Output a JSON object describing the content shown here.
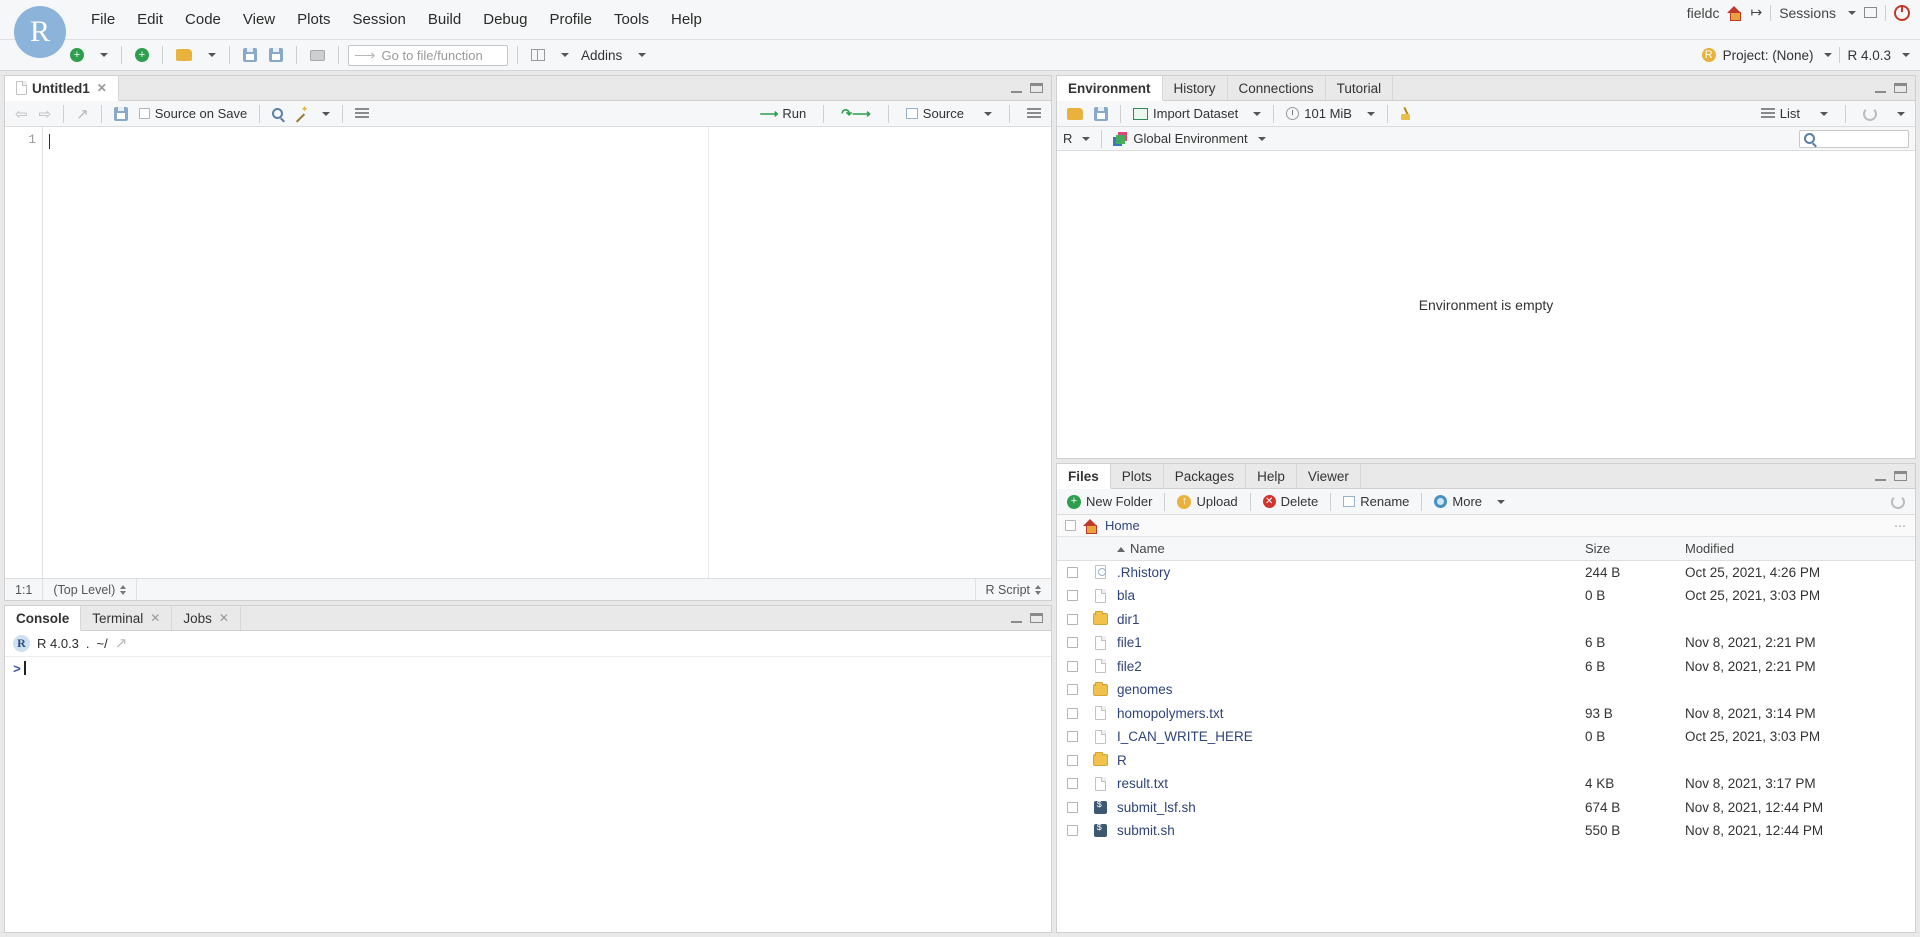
{
  "app": {
    "logo_letter": "R",
    "menus": [
      "File",
      "Edit",
      "Code",
      "View",
      "Plots",
      "Session",
      "Build",
      "Debug",
      "Profile",
      "Tools",
      "Help"
    ],
    "user": "fieldc",
    "sessions_label": "Sessions",
    "project_label": "Project: (None)",
    "r_version": "R 4.0.3"
  },
  "toolbar": {
    "goto_placeholder": "Go to file/function",
    "addins_label": "Addins"
  },
  "source": {
    "tabs": [
      {
        "label": "Untitled1",
        "closable": true
      }
    ],
    "line_numbers": [
      "1"
    ],
    "code_line": "",
    "actions": {
      "source_on_save": "Source on Save",
      "run": "Run",
      "source": "Source"
    },
    "status": {
      "position": "1:1",
      "scope": "(Top Level)",
      "filetype": "R Script"
    }
  },
  "console": {
    "tabs": [
      "Console",
      "Terminal",
      "Jobs"
    ],
    "active_tab": "Console",
    "header_version": "R 4.0.3",
    "header_path": "~/",
    "prompt": ">"
  },
  "environment": {
    "tabs": [
      "Environment",
      "History",
      "Connections",
      "Tutorial"
    ],
    "active_tab": "Environment",
    "toolbar": {
      "import_dataset": "Import Dataset",
      "memory": "101 MiB",
      "view_mode": "List"
    },
    "scope": {
      "language": "R",
      "environment": "Global Environment"
    },
    "empty_message": "Environment is empty"
  },
  "files": {
    "tabs": [
      "Files",
      "Plots",
      "Packages",
      "Help",
      "Viewer"
    ],
    "active_tab": "Files",
    "toolbar": {
      "new_folder": "New Folder",
      "upload": "Upload",
      "delete": "Delete",
      "rename": "Rename",
      "more": "More"
    },
    "path": "Home",
    "columns": {
      "name": "Name",
      "size": "Size",
      "modified": "Modified"
    },
    "sort_column": "Name",
    "rows": [
      {
        "icon": "history-file-icon",
        "name": ".Rhistory",
        "size": "244 B",
        "modified": "Oct 25, 2021, 4:26 PM"
      },
      {
        "icon": "file-icon",
        "name": "bla",
        "size": "0 B",
        "modified": "Oct 25, 2021, 3:03 PM"
      },
      {
        "icon": "folder-icon",
        "name": "dir1",
        "size": "",
        "modified": ""
      },
      {
        "icon": "file-icon",
        "name": "file1",
        "size": "6 B",
        "modified": "Nov 8, 2021, 2:21 PM"
      },
      {
        "icon": "file-icon",
        "name": "file2",
        "size": "6 B",
        "modified": "Nov 8, 2021, 2:21 PM"
      },
      {
        "icon": "folder-icon",
        "name": "genomes",
        "size": "",
        "modified": ""
      },
      {
        "icon": "file-icon",
        "name": "homopolymers.txt",
        "size": "93 B",
        "modified": "Nov 8, 2021, 3:14 PM"
      },
      {
        "icon": "file-icon",
        "name": "I_CAN_WRITE_HERE",
        "size": "0 B",
        "modified": "Oct 25, 2021, 3:03 PM"
      },
      {
        "icon": "folder-icon",
        "name": "R",
        "size": "",
        "modified": ""
      },
      {
        "icon": "file-icon",
        "name": "result.txt",
        "size": "4 KB",
        "modified": "Nov 8, 2021, 3:17 PM"
      },
      {
        "icon": "shell-icon",
        "name": "submit_lsf.sh",
        "size": "674 B",
        "modified": "Nov 8, 2021, 12:44 PM"
      },
      {
        "icon": "shell-icon",
        "name": "submit.sh",
        "size": "550 B",
        "modified": "Nov 8, 2021, 12:44 PM"
      }
    ]
  },
  "colors": {
    "accent_blue": "#8cb3d9",
    "link_blue": "#31447a",
    "green": "#2e9e4f",
    "folder_yellow": "#f0c14b",
    "red": "#c0392b"
  }
}
